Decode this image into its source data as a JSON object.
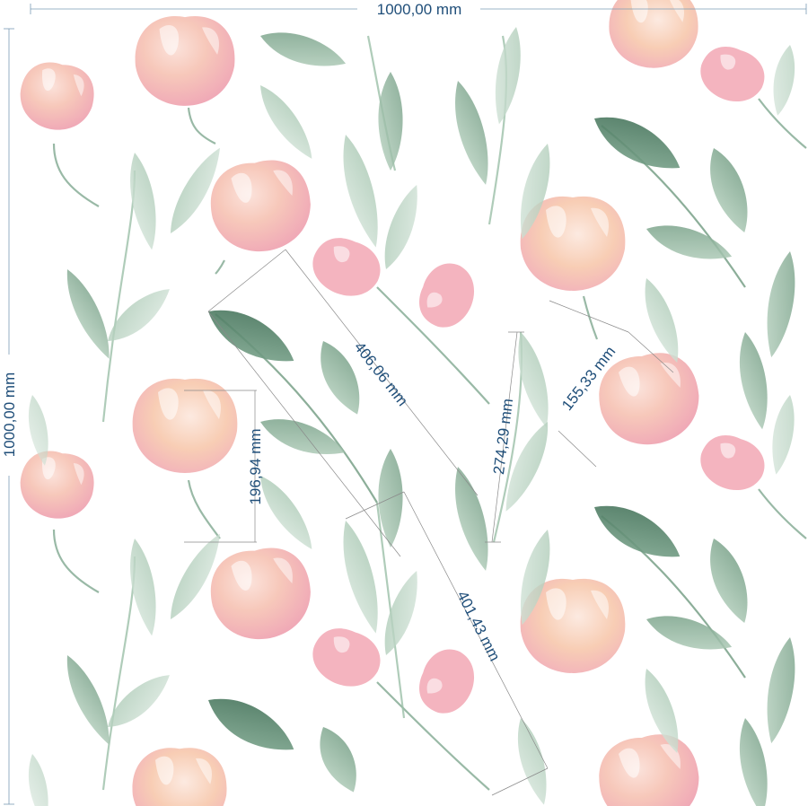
{
  "dimensions": {
    "width_label": "1000,00 mm",
    "height_label": "1000,00 mm"
  },
  "measurements": [
    {
      "id": "flower-height",
      "label": "196,94 mm"
    },
    {
      "id": "leaf-spray-diagonal",
      "label": "406,06 mm"
    },
    {
      "id": "stem-height",
      "label": "274,29 mm"
    },
    {
      "id": "bud-diagonal",
      "label": "155,33 mm"
    },
    {
      "id": "lower-spray-diagonal",
      "label": "401,43 mm"
    }
  ],
  "colors": {
    "petal_pink": "#f2a7b4",
    "petal_peach": "#f6c3a6",
    "leaf_dark": "#4f7d62",
    "leaf_light": "#9bbfa7",
    "dimension_text": "#1f4e79"
  }
}
